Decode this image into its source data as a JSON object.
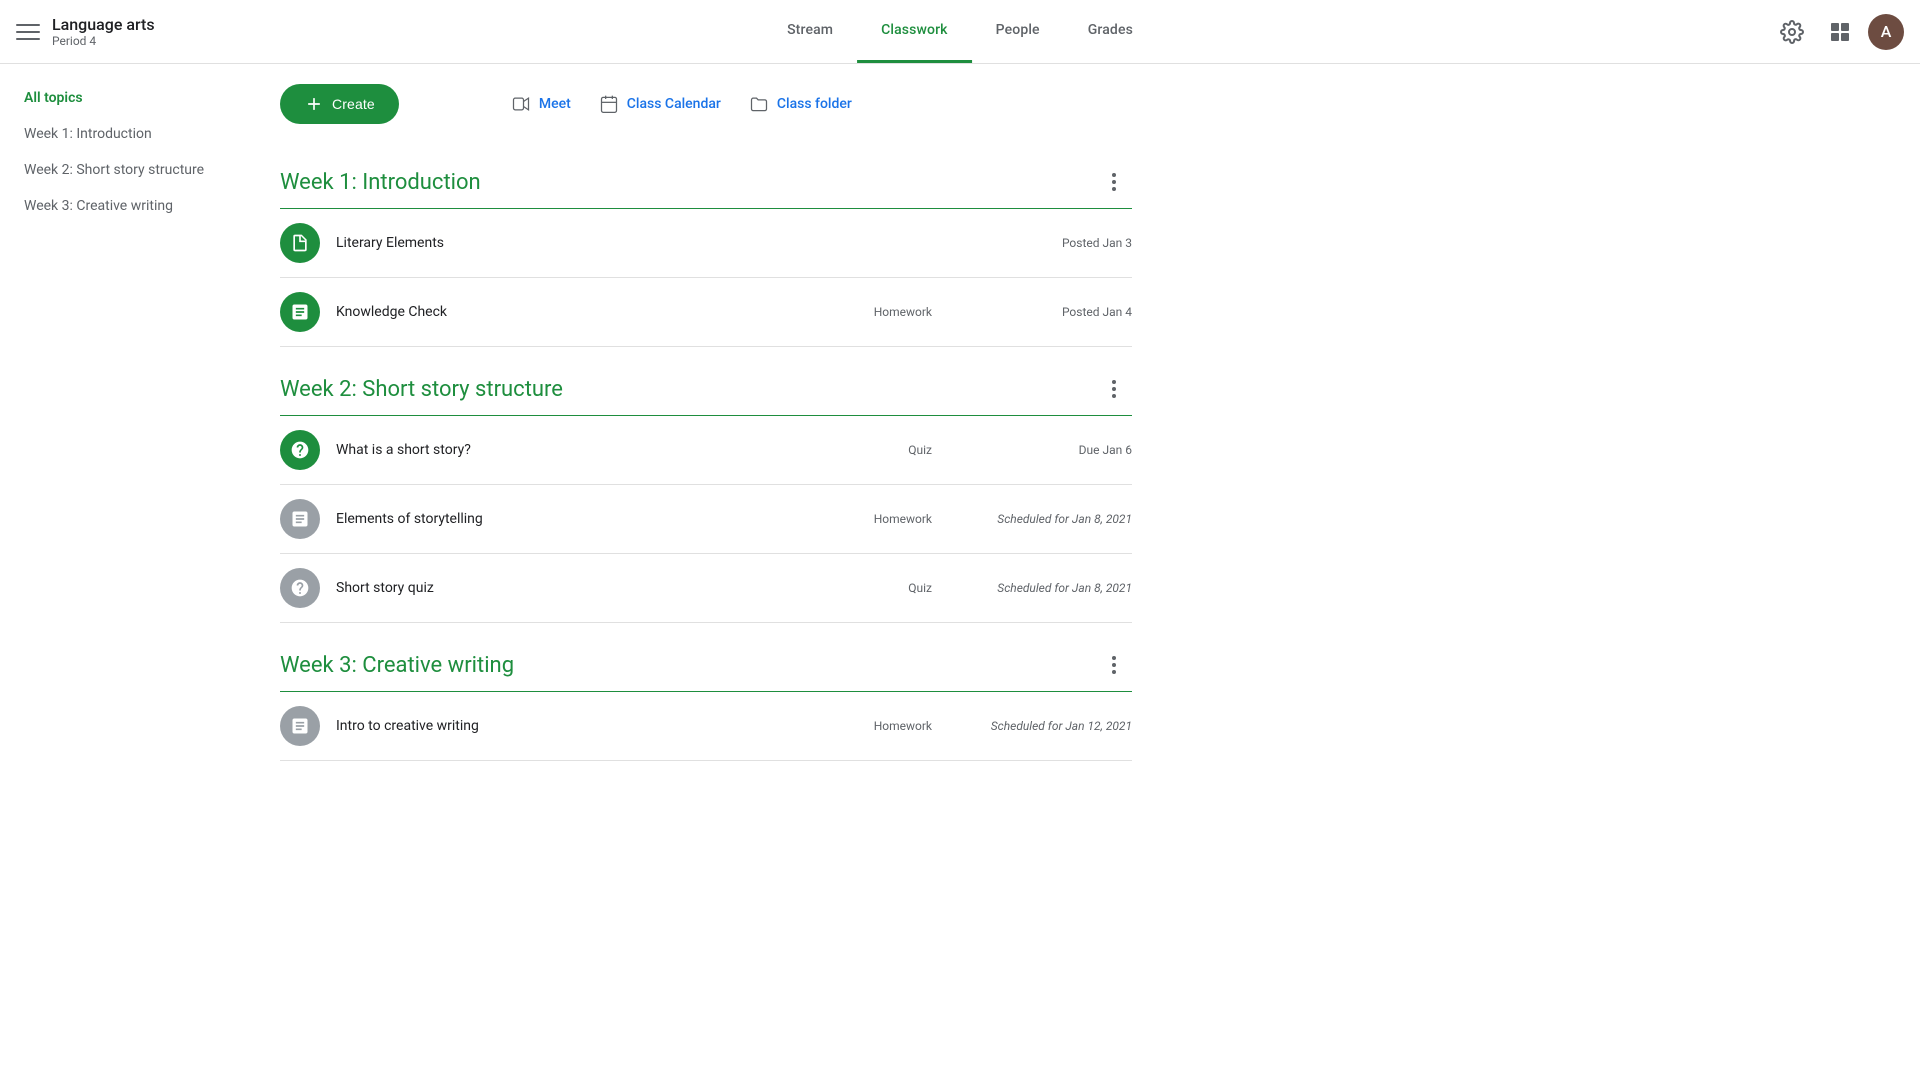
{
  "header": {
    "menu_label": "Menu",
    "app_title": "Language arts",
    "app_subtitle": "Period 4",
    "nav_tabs": [
      {
        "id": "stream",
        "label": "Stream",
        "active": false
      },
      {
        "id": "classwork",
        "label": "Classwork",
        "active": true
      },
      {
        "id": "people",
        "label": "People",
        "active": false
      },
      {
        "id": "grades",
        "label": "Grades",
        "active": false
      }
    ],
    "settings_label": "Settings",
    "apps_label": "Google apps",
    "avatar_initial": "A"
  },
  "toolbar": {
    "create_label": "Create",
    "meet_label": "Meet",
    "class_calendar_label": "Class Calendar",
    "class_folder_label": "Class folder"
  },
  "sidebar": {
    "items": [
      {
        "id": "all-topics",
        "label": "All topics",
        "active": true
      },
      {
        "id": "week1",
        "label": "Week 1: Introduction",
        "active": false
      },
      {
        "id": "week2",
        "label": "Week 2: Short story structure",
        "active": false
      },
      {
        "id": "week3",
        "label": "Week 3: Creative writing",
        "active": false
      }
    ]
  },
  "sections": [
    {
      "id": "week1",
      "title": "Week 1: Introduction",
      "assignments": [
        {
          "id": "literary-elements",
          "name": "Literary Elements",
          "type": "",
          "date": "Posted Jan 3",
          "date_scheduled": false,
          "icon_type": "green",
          "icon_symbol": "material"
        },
        {
          "id": "knowledge-check",
          "name": "Knowledge Check",
          "type": "Homework",
          "date": "Posted Jan 4",
          "date_scheduled": false,
          "icon_type": "green",
          "icon_symbol": "assignment"
        }
      ]
    },
    {
      "id": "week2",
      "title": "Week 2: Short story structure",
      "assignments": [
        {
          "id": "what-is-short-story",
          "name": "What is a short story?",
          "type": "Quiz",
          "date": "Due Jan 6",
          "date_scheduled": false,
          "icon_type": "green",
          "icon_symbol": "quiz"
        },
        {
          "id": "elements-of-storytelling",
          "name": "Elements of storytelling",
          "type": "Homework",
          "date": "Scheduled for Jan 8, 2021",
          "date_scheduled": true,
          "icon_type": "gray",
          "icon_symbol": "assignment"
        },
        {
          "id": "short-story-quiz",
          "name": "Short story quiz",
          "type": "Quiz",
          "date": "Scheduled for Jan 8, 2021",
          "date_scheduled": true,
          "icon_type": "gray",
          "icon_symbol": "quiz"
        }
      ]
    },
    {
      "id": "week3",
      "title": "Week 3: Creative writing",
      "assignments": [
        {
          "id": "intro-creative-writing",
          "name": "Intro to creative writing",
          "type": "Homework",
          "date": "Scheduled for Jan 12, 2021",
          "date_scheduled": true,
          "icon_type": "gray",
          "icon_symbol": "assignment"
        }
      ]
    }
  ]
}
